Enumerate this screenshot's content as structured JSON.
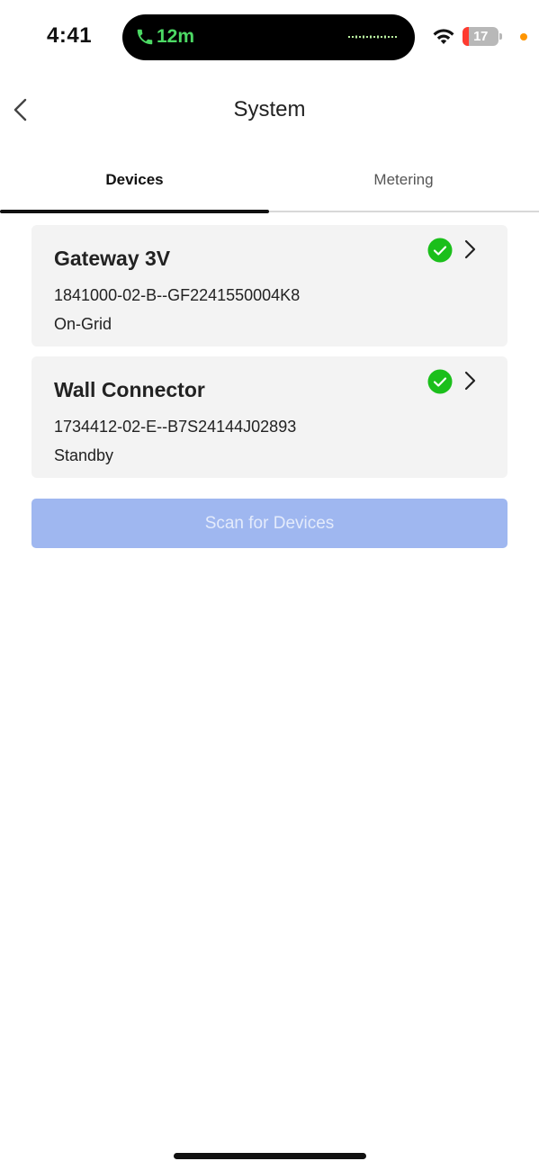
{
  "status_bar": {
    "time": "4:41",
    "call_timer": "12m",
    "battery_level": "17",
    "battery_fraction": 0.17,
    "icons": [
      "phone-icon",
      "waveform-icon",
      "wifi-icon",
      "battery-icon",
      "privacy-dot"
    ],
    "colors": {
      "call": "#4cd964",
      "battery_low": "#ff3b30",
      "privacy_dot": "#ff9500"
    }
  },
  "nav": {
    "title": "System",
    "back_icon": "chevron-left-icon"
  },
  "tabs": [
    {
      "label": "Devices",
      "selected": true
    },
    {
      "label": "Metering",
      "selected": false
    }
  ],
  "devices": [
    {
      "name": "Gateway 3V",
      "serial": "1841000-02-B--GF2241550004K8",
      "status": "On-Grid",
      "status_icon": "check-circle-icon",
      "nav_icon": "chevron-right-icon"
    },
    {
      "name": "Wall Connector",
      "serial": "1734412-02-E--B7S24144J02893",
      "status": "Standby",
      "status_icon": "check-circle-icon",
      "nav_icon": "chevron-right-icon"
    }
  ],
  "scan_button": {
    "label": "Scan for Devices",
    "enabled": false
  },
  "colors": {
    "check_green": "#1bbf1b",
    "card_bg": "#f3f3f3",
    "scan_button_bg": "#9fb7f0",
    "tab_indicator": "#111111"
  }
}
